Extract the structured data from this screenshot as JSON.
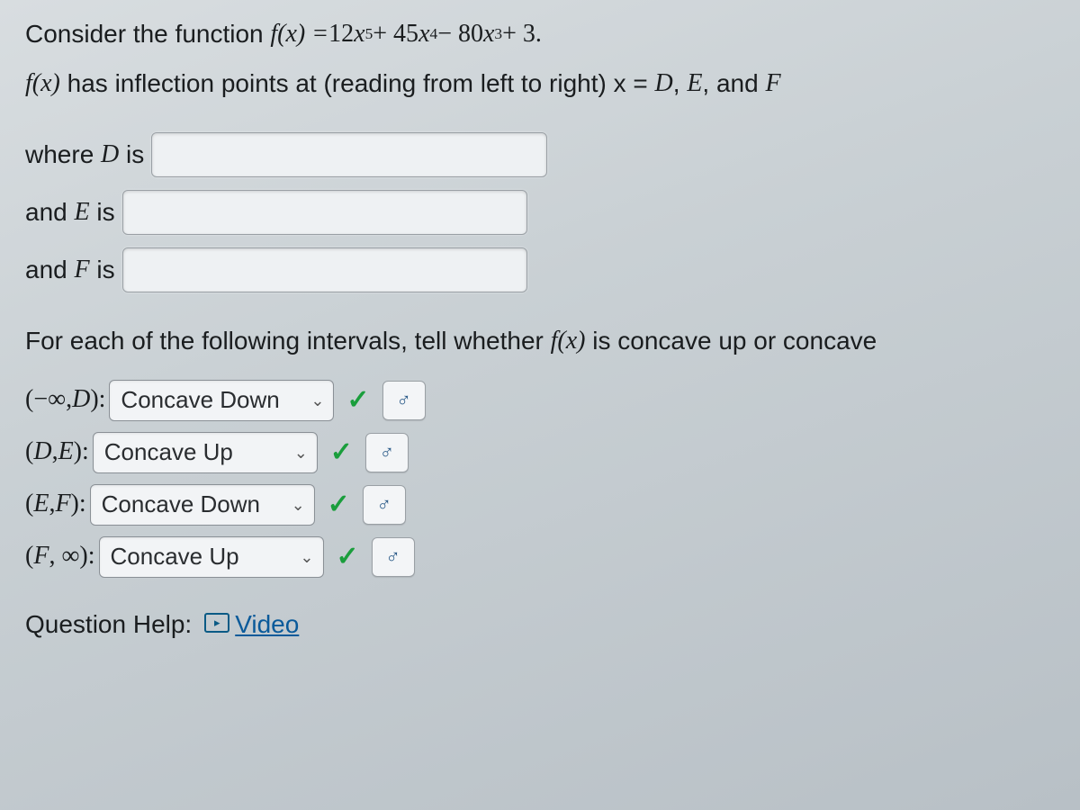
{
  "problem": {
    "consider_prefix": "Consider the function ",
    "fx_eq": "f(x) = ",
    "poly_12": "12",
    "poly_x5": "x",
    "poly_exp5": "5",
    "poly_plus45": " + 45",
    "poly_x4": "x",
    "poly_exp4": "4",
    "poly_minus80": " − 80",
    "poly_x3": "x",
    "poly_exp3": "3",
    "poly_plus3": " + 3.",
    "inflect_prefix": "f(x)",
    "inflect_rest": " has inflection points at (reading from left to right) x = ",
    "D": "D",
    "E": "E",
    "F": "F",
    "comma_and": ", and ",
    "comma": ", "
  },
  "labels": {
    "where_D": "where ",
    "and_E": "and ",
    "and_F": "and ",
    "D_is": " is",
    "E_is": " is",
    "F_is": " is"
  },
  "instr": {
    "line": "For each of the following intervals, tell whether ",
    "fx": "f(x)",
    "tail": " is concave up or concave"
  },
  "intervals": [
    {
      "open": "(−∞, ",
      "var": "D",
      "close": "): ",
      "selected": "Concave Down"
    },
    {
      "open": "(",
      "var1": "D",
      "mid": ", ",
      "var2": "E",
      "close": "): ",
      "selected": "Concave Up"
    },
    {
      "open": "(",
      "var1": "E",
      "mid": ", ",
      "var2": "F",
      "close": "): ",
      "selected": "Concave Down"
    },
    {
      "open": "(",
      "var1": "F",
      "mid": ", ∞): ",
      "selected": "Concave Up"
    }
  ],
  "help": {
    "label": "Question Help:",
    "video": "Video"
  },
  "icons": {
    "caret": "⌄",
    "check": "✓",
    "preview": "♂",
    "play": "▸"
  }
}
